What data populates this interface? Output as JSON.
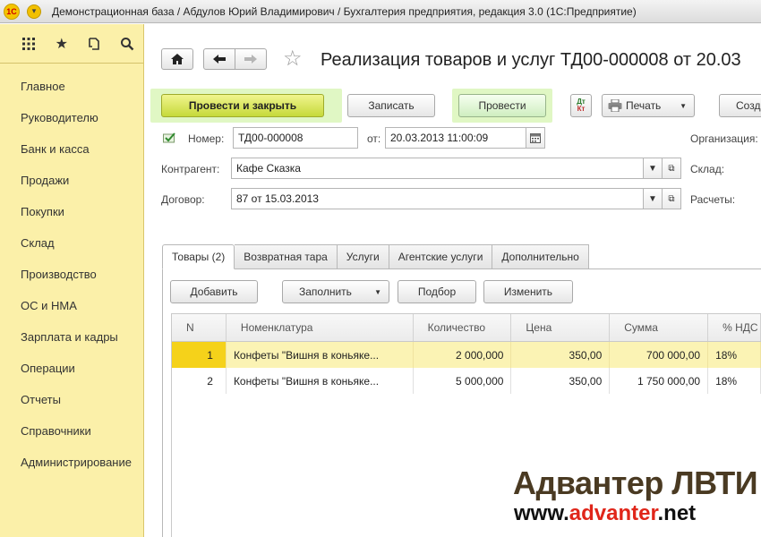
{
  "window": {
    "title": "Демонстрационная база / Абдулов Юрий Владимирович / Бухгалтерия предприятия, редакция 3.0  (1С:Предприятие)",
    "logo_text": "1С"
  },
  "sidebar": {
    "items": [
      {
        "label": "Главное"
      },
      {
        "label": "Руководителю"
      },
      {
        "label": "Банк и касса"
      },
      {
        "label": "Продажи"
      },
      {
        "label": "Покупки"
      },
      {
        "label": "Склад"
      },
      {
        "label": "Производство"
      },
      {
        "label": "ОС и НМА"
      },
      {
        "label": "Зарплата и кадры"
      },
      {
        "label": "Операции"
      },
      {
        "label": "Отчеты"
      },
      {
        "label": "Справочники"
      },
      {
        "label": "Администрирование"
      }
    ]
  },
  "document": {
    "title": "Реализация товаров и услуг ТД00-000008 от 20.03",
    "toolbar": {
      "post_close": "Провести и закрыть",
      "save": "Записать",
      "post": "Провести",
      "dtkt_top": "Дт",
      "dtkt_bottom": "Кт",
      "print": "Печать",
      "create": "Созд"
    },
    "fields": {
      "number_label": "Номер:",
      "number_value": "ТД00-000008",
      "date_label": "от:",
      "date_value": "20.03.2013 11:00:09",
      "org_label": "Организация:",
      "contractor_label": "Контрагент:",
      "contractor_value": "Кафе Сказка",
      "warehouse_label": "Склад:",
      "contract_label": "Договор:",
      "contract_value": "87 от 15.03.2013",
      "settlements_label": "Расчеты:"
    },
    "tabs": [
      {
        "label": "Товары (2)",
        "active": true
      },
      {
        "label": "Возвратная тара"
      },
      {
        "label": "Услуги"
      },
      {
        "label": "Агентские услуги"
      },
      {
        "label": "Дополнительно"
      }
    ],
    "table_toolbar": {
      "add": "Добавить",
      "fill": "Заполнить",
      "pick": "Подбор",
      "edit": "Изменить"
    },
    "table": {
      "columns": [
        "N",
        "Номенклатура",
        "Количество",
        "Цена",
        "Сумма",
        "% НДС"
      ],
      "rows": [
        {
          "n": "1",
          "item": "Конфеты \"Вишня в коньяке...",
          "qty": "2 000,000",
          "price": "350,00",
          "sum": "700 000,00",
          "vat": "18%"
        },
        {
          "n": "2",
          "item": "Конфеты \"Вишня в коньяке...",
          "qty": "5 000,000",
          "price": "350,00",
          "sum": "1 750 000,00",
          "vat": "18%"
        }
      ]
    }
  },
  "watermark": {
    "line1": "Адвантер ЛВТИ",
    "line2_a": "www.",
    "line2_b": "advanter",
    "line2_c": ".net"
  }
}
